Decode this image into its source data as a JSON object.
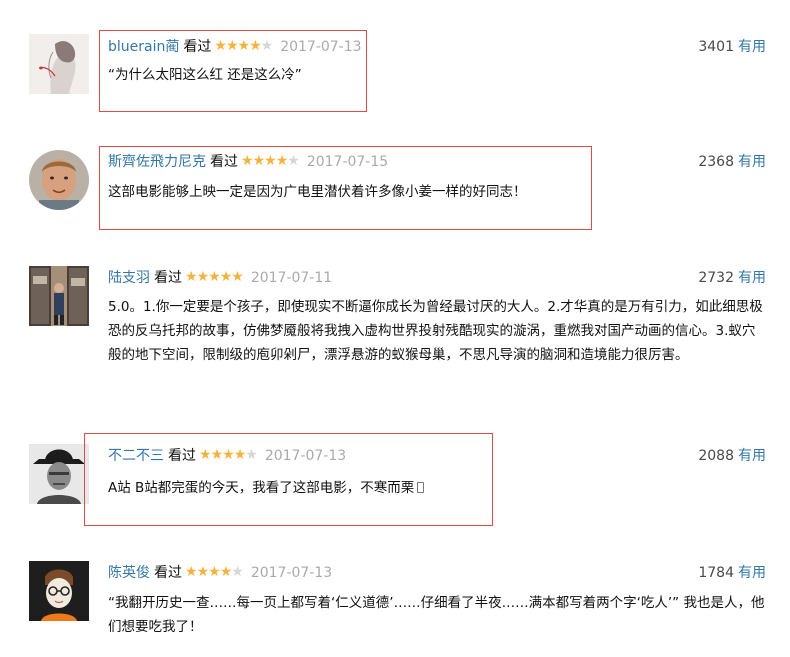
{
  "reviews": [
    {
      "user": "bluerain蔺",
      "status": "看过",
      "rating": 4,
      "date": "2017-07-13",
      "votes": "3401",
      "useful_label": "有用",
      "content": "“为什么太阳这么红 还是这么冷”"
    },
    {
      "user": "斯齊佐飛力尼克",
      "status": "看过",
      "rating": 4,
      "date": "2017-07-15",
      "votes": "2368",
      "useful_label": "有用",
      "content": "这部电影能够上映一定是因为广电里潜伏着许多像小姜一样的好同志！"
    },
    {
      "user": "陆支羽",
      "status": "看过",
      "rating": 5,
      "date": "2017-07-11",
      "votes": "2732",
      "useful_label": "有用",
      "content": "5.0。1.你一定要是个孩子，即使现实不断逼你成长为曾经最讨厌的大人。2.才华真的是万有引力，如此细思极恐的反乌托邦的故事，仿佛梦魇般将我拽入虚构世界投射残酷现实的漩涡，重燃我对国产动画的信心。3.蚁穴般的地下空间，限制级的庖卯剁尸，漂浮悬游的蚁猴母巢，不思凡导演的脑洞和造境能力很厉害。"
    },
    {
      "user": "不二不三",
      "status": "看过",
      "rating": 4,
      "date": "2017-07-13",
      "votes": "2088",
      "useful_label": "有用",
      "content": "A站 B站都完蛋的今天，我看了这部电影，不寒而栗"
    },
    {
      "user": "陈英俊",
      "status": "看过",
      "rating": 4,
      "date": "2017-07-13",
      "votes": "1784",
      "useful_label": "有用",
      "content": "“我翻开历史一查……每一页上都写着‘仁义道德’……仔细看了半夜……满本都写着两个字‘吃人’” 我也是人，他们想要吃我了！"
    }
  ],
  "colors": {
    "link": "#3377aa",
    "star_on": "#f4b33d",
    "star_off": "#d6d6d6",
    "highlight_border": "#e04a4a",
    "date": "#aaaaaa"
  },
  "icons": {
    "star": "star-icon",
    "phone": "phone-icon"
  }
}
